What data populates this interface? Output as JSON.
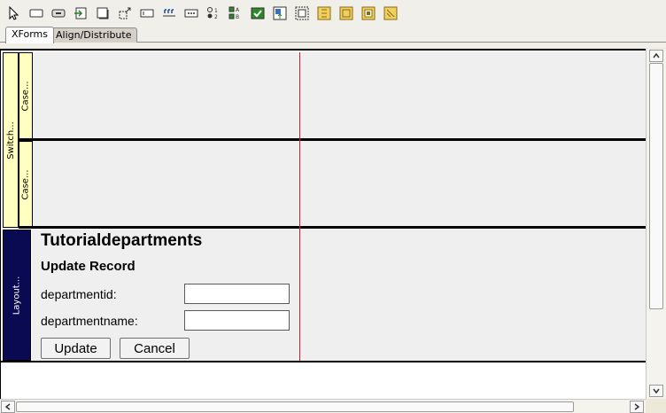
{
  "toolbar": {
    "icons": [
      "pointer-icon",
      "rectangle-icon",
      "button-icon",
      "input-icon",
      "frame-icon",
      "transform-icon",
      "textbox-icon",
      "range-icon",
      "secret-icon",
      "select-one-icon",
      "select-many-icon",
      "checkbox-icon",
      "upload-icon",
      "group-icon",
      "repeat-icon",
      "switch-icon",
      "case-icon",
      "layout-icon"
    ]
  },
  "tabs": [
    {
      "label": "XForms",
      "active": true
    },
    {
      "label": "Align/Distribute",
      "active": false
    }
  ],
  "canvas": {
    "switch_label": "Switch...",
    "case_label_1": "Case...",
    "case_label_2": "Case...",
    "layout_label": "Layout...",
    "form": {
      "title": "Tutorialdepartments",
      "subtitle": "Update Record",
      "fields": [
        {
          "label": "departmentid:",
          "value": ""
        },
        {
          "label": "departmentname:",
          "value": ""
        }
      ],
      "update_label": "Update",
      "cancel_label": "Cancel"
    }
  },
  "colors": {
    "switch_case_bg": "#ffffc0",
    "layout_bg": "#0a0a52",
    "guide_line": "#c81e1e"
  }
}
